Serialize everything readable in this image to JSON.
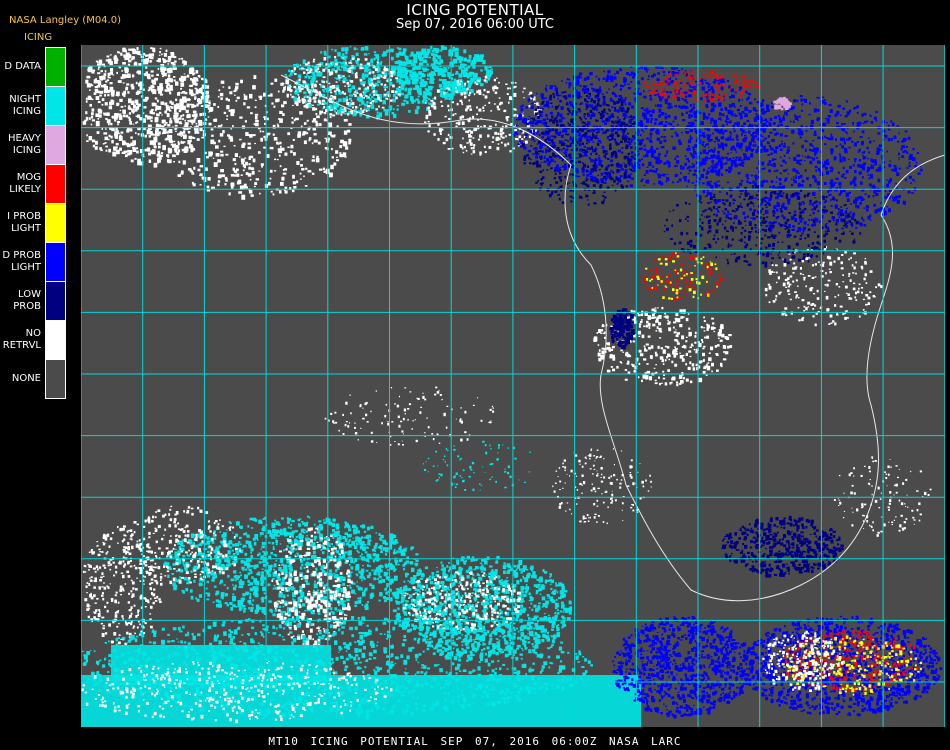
{
  "header": {
    "title": "ICING POTENTIAL",
    "subtitle": "Sep 07, 2016 06:00 UTC",
    "producer": "NASA Langley (M04.0)",
    "legend_title": "ICING"
  },
  "legend": [
    {
      "label": "D DATA",
      "color": "#00b000"
    },
    {
      "label": "NIGHT\nICING",
      "color": "#00e5e5"
    },
    {
      "label": "HEAVY\nICING",
      "color": "#e0a8e0"
    },
    {
      "label": "MOG\nLIKELY",
      "color": "#ff0000"
    },
    {
      "label": "I PROB\nLIGHT",
      "color": "#ffff00"
    },
    {
      "label": "D PROB\nLIGHT",
      "color": "#0000ff"
    },
    {
      "label": "LOW\nPROB",
      "color": "#000080"
    },
    {
      "label": "NO\nRETRVL",
      "color": "#ffffff"
    },
    {
      "label": "NONE",
      "color": "#4b4b4b"
    }
  ],
  "map": {
    "background": "#4b4b4b",
    "grid_color": "#00d8d8",
    "coast_color": "#e8e8e8",
    "label_color": "#cc3333"
  },
  "footer": "MT10  ICING POTENTIAL   SEP 07, 2016 06:00Z   NASA LARC"
}
